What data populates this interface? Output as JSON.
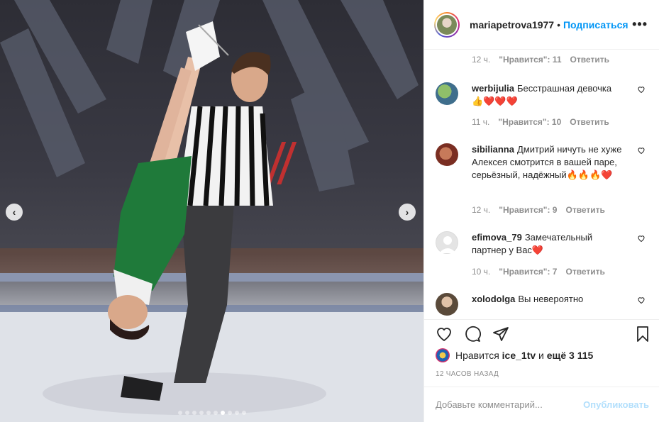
{
  "post": {
    "username": "mariapetrova1977",
    "separator": "•",
    "follow_label": "Подписаться",
    "more_label": "•••"
  },
  "photo": {
    "prev_label": "‹",
    "next_label": "›",
    "slide_count": 10,
    "active_slide": 6
  },
  "top_meta": {
    "time": "12 ч.",
    "likes": "\"Нравится\": 11",
    "reply": "Ответить"
  },
  "comments": [
    {
      "user": "werbijulia",
      "text": "Бесстрашная девочка 👍❤️❤️❤️",
      "time": "11 ч.",
      "likes": "\"Нравится\": 10",
      "reply": "Ответить"
    },
    {
      "user": "sibilianna",
      "text": "Дмитрий ничуть не хуже Алексея смотрится в вашей паре, серьёзный, надёжный🔥🔥🔥❤️",
      "time": "12 ч.",
      "likes": "\"Нравится\": 9",
      "reply": "Ответить"
    },
    {
      "user": "efimova_79",
      "text": "Замечательный партнер у Вас❤️",
      "time": "10 ч.",
      "likes": "\"Нравится\": 7",
      "reply": "Ответить"
    },
    {
      "user": "xolodolga",
      "text": "Вы невероятно",
      "time": "",
      "likes": "",
      "reply": ""
    }
  ],
  "actions": {
    "likes_prefix": "Нравится",
    "likes_user": "ice_1tv",
    "likes_conj": "и",
    "likes_rest": "ещё 3 115",
    "time_ago": "12 ЧАСОВ НАЗАД"
  },
  "add_comment": {
    "placeholder": "Добавьте комментарий...",
    "publish_label": "Опубликовать"
  },
  "colors": {
    "accent": "#0095f6",
    "text": "#262626",
    "muted": "#8e8e8e",
    "publish_disabled": "#b2dffc"
  }
}
